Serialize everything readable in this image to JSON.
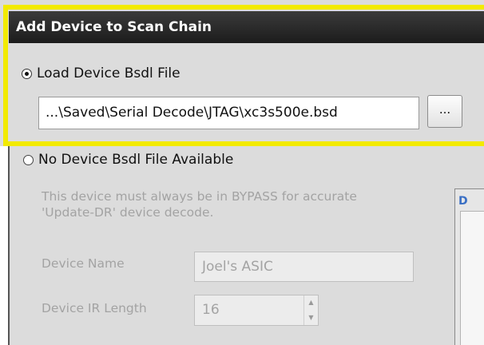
{
  "dialog": {
    "title": "Add Device to Scan Chain",
    "accent_color": "#f2ea00",
    "titlebar_color": "#2a2a2a"
  },
  "load_option": {
    "label": "Load Device Bsdl File",
    "selected": true,
    "file_path": "...\\Saved\\Serial Decode\\JTAG\\xc3s500e.bsd",
    "browse_label": "..."
  },
  "no_file_option": {
    "label": "No Device Bsdl File Available",
    "selected": false,
    "note_line1": "This device must always be in BYPASS for accurate",
    "note_line2": "'Update-DR' device decode.",
    "device_name_label": "Device Name",
    "device_name_value": "Joel's ASIC",
    "ir_length_label": "Device IR Length",
    "ir_length_value": "16"
  },
  "side_panel": {
    "label": "D"
  },
  "icons": {
    "radio_checked": "radio-checked-icon",
    "radio_unchecked": "radio-unchecked-icon",
    "spin_up": "chevron-up-icon",
    "spin_down": "chevron-down-icon"
  }
}
